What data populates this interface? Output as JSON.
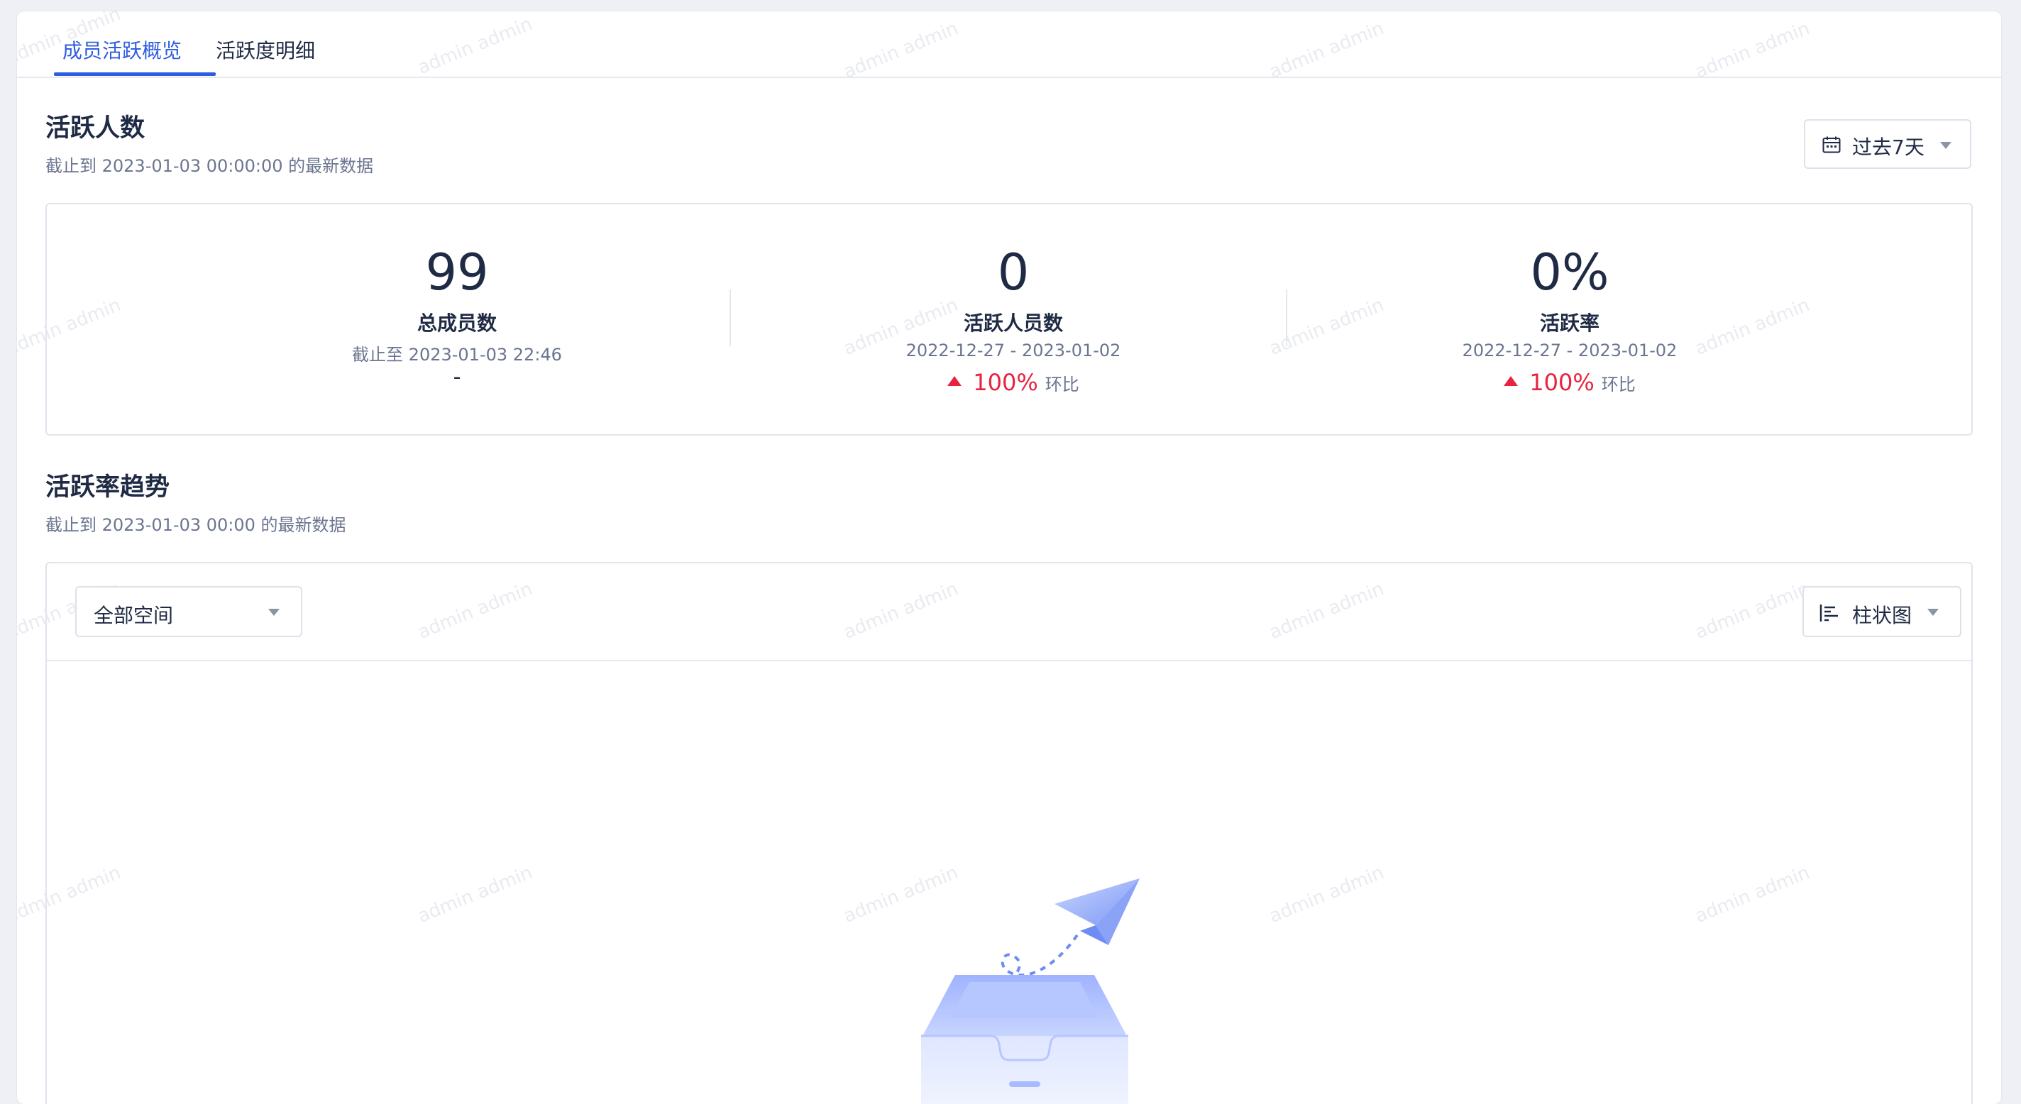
{
  "tabs": [
    {
      "label": "成员活跃概览",
      "active": true
    },
    {
      "label": "活跃度明细",
      "active": false
    }
  ],
  "active_section": {
    "title": "活跃人数",
    "subtitle": "截止到 2023-01-03 00:00:00 的最新数据",
    "date_range_button": {
      "label": "过去7天",
      "icon": "calendar-icon"
    }
  },
  "stats": [
    {
      "value": "99",
      "name": "总成员数",
      "period": "截止至 2023-01-03 22:46",
      "change": "-",
      "compare_label": ""
    },
    {
      "value": "0",
      "name": "活跃人员数",
      "period": "2022-12-27 - 2023-01-02",
      "change": "100%",
      "compare_label": "环比",
      "direction": "up"
    },
    {
      "value": "0%",
      "name": "活跃率",
      "period": "2022-12-27 - 2023-01-02",
      "change": "100%",
      "compare_label": "环比",
      "direction": "up"
    }
  ],
  "trend_section": {
    "title": "活跃率趋势",
    "subtitle": "截止到 2023-01-03 00:00 的最新数据",
    "space_select": {
      "value": "全部空间"
    },
    "chart_type_select": {
      "value": "柱状图",
      "icon": "bar-chart-icon"
    },
    "empty_state_icon": "empty-inbox-paper-plane-icon"
  },
  "watermark_text": "admin admin",
  "colors": {
    "accent": "#2f5de0",
    "increase": "#e8233f",
    "text": "#1f2a44",
    "muted": "#6b7590"
  }
}
